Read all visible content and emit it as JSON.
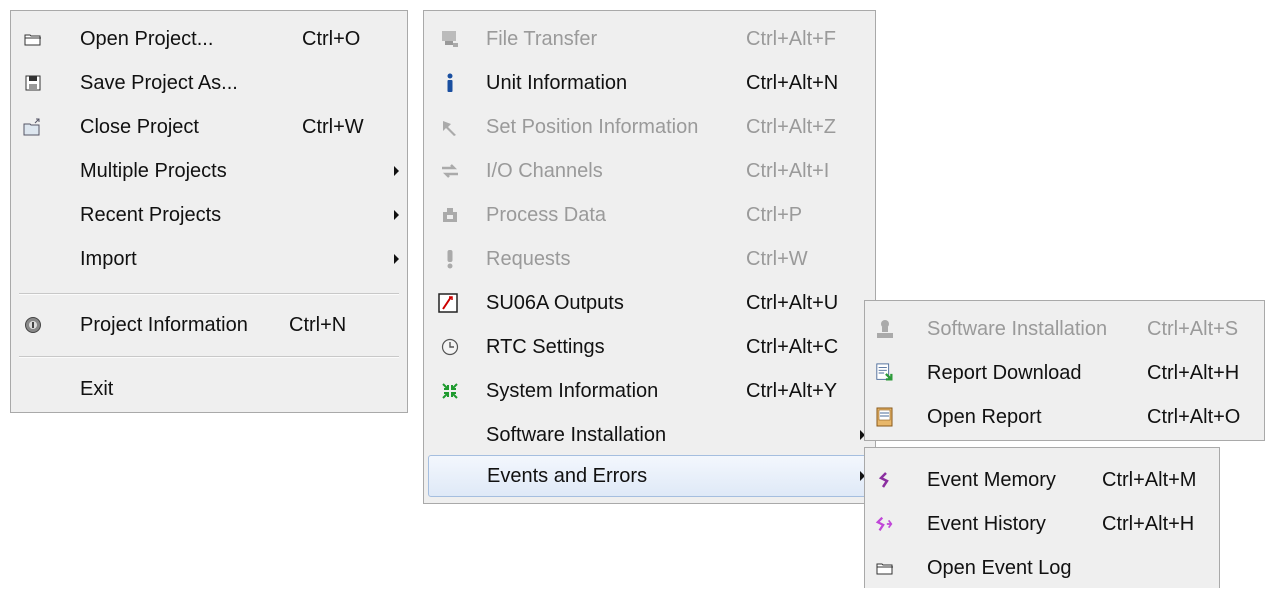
{
  "menu_file": {
    "items": [
      {
        "label": "Open Project...",
        "shortcut": "Ctrl+O",
        "icon": "folder-open-icon"
      },
      {
        "label": "Save Project As...",
        "shortcut": "",
        "icon": "save-icon"
      },
      {
        "label": "Close Project",
        "shortcut": "Ctrl+W",
        "icon": "close-project-icon"
      },
      {
        "label": "Multiple Projects",
        "shortcut": ""
      },
      {
        "label": "Recent Projects",
        "shortcut": ""
      },
      {
        "label": "Import",
        "shortcut": ""
      },
      {
        "label": "Project Information",
        "shortcut": "Ctrl+N",
        "icon": "project-info-icon"
      },
      {
        "label": "Exit",
        "shortcut": ""
      }
    ]
  },
  "menu_unit": {
    "items": [
      {
        "label": "File Transfer",
        "shortcut": "Ctrl+Alt+F",
        "icon": "file-transfer-icon"
      },
      {
        "label": "Unit Information",
        "shortcut": "Ctrl+Alt+N",
        "icon": "info-icon"
      },
      {
        "label": "Set Position Information",
        "shortcut": "Ctrl+Alt+Z",
        "icon": "pin-icon"
      },
      {
        "label": "I/O Channels",
        "shortcut": "Ctrl+Alt+I",
        "icon": "arrows-icon"
      },
      {
        "label": "Process Data",
        "shortcut": "Ctrl+P",
        "icon": "process-data-icon"
      },
      {
        "label": "Requests",
        "shortcut": "Ctrl+W",
        "icon": "exclamation-icon"
      },
      {
        "label": "SU06A Outputs",
        "shortcut": "Ctrl+Alt+U",
        "icon": "gauge-icon"
      },
      {
        "label": "RTC Settings",
        "shortcut": "Ctrl+Alt+C",
        "icon": "clock-icon"
      },
      {
        "label": "System Information",
        "shortcut": "Ctrl+Alt+Y",
        "icon": "system-info-icon"
      },
      {
        "label": "Software Installation",
        "shortcut": ""
      },
      {
        "label": "Events and Errors",
        "shortcut": ""
      }
    ]
  },
  "menu_software": {
    "items": [
      {
        "label": "Software Installation",
        "shortcut": "Ctrl+Alt+S",
        "icon": "install-icon"
      },
      {
        "label": "Report Download",
        "shortcut": "Ctrl+Alt+H",
        "icon": "report-download-icon"
      },
      {
        "label": "Open Report",
        "shortcut": "Ctrl+Alt+O",
        "icon": "open-report-icon"
      }
    ]
  },
  "menu_events": {
    "items": [
      {
        "label": "Event Memory",
        "shortcut": "Ctrl+Alt+M",
        "icon": "event-memory-icon"
      },
      {
        "label": "Event History",
        "shortcut": "Ctrl+Alt+H",
        "icon": "event-history-icon"
      },
      {
        "label": "Open Event Log",
        "shortcut": "",
        "icon": "folder-open-icon"
      }
    ]
  }
}
